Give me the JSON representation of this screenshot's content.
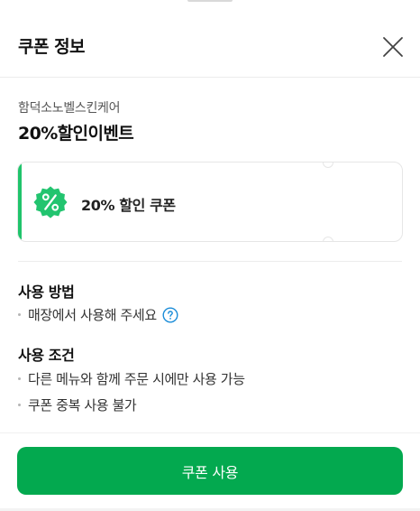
{
  "header": {
    "title": "쿠폰 정보",
    "close_icon": "close-icon"
  },
  "event": {
    "store_name": "함덕소노벨스킨케어",
    "title": "20%할인이벤트"
  },
  "coupon": {
    "badge_icon": "percent-badge-icon",
    "label": "20% 할인 쿠폰",
    "accent_color": "#1fc46b"
  },
  "usage_method": {
    "title": "사용 방법",
    "items": [
      {
        "text": "매장에서 사용해 주세요",
        "help_icon": "question-circle-icon"
      }
    ]
  },
  "usage_conditions": {
    "title": "사용 조건",
    "items": [
      {
        "text": "다른 메뉴와 함께 주문 시에만 사용 가능"
      },
      {
        "text": "쿠폰 중복 사용 불가"
      }
    ]
  },
  "footer": {
    "use_button_label": "쿠폰 사용",
    "button_color": "#03a94f"
  }
}
